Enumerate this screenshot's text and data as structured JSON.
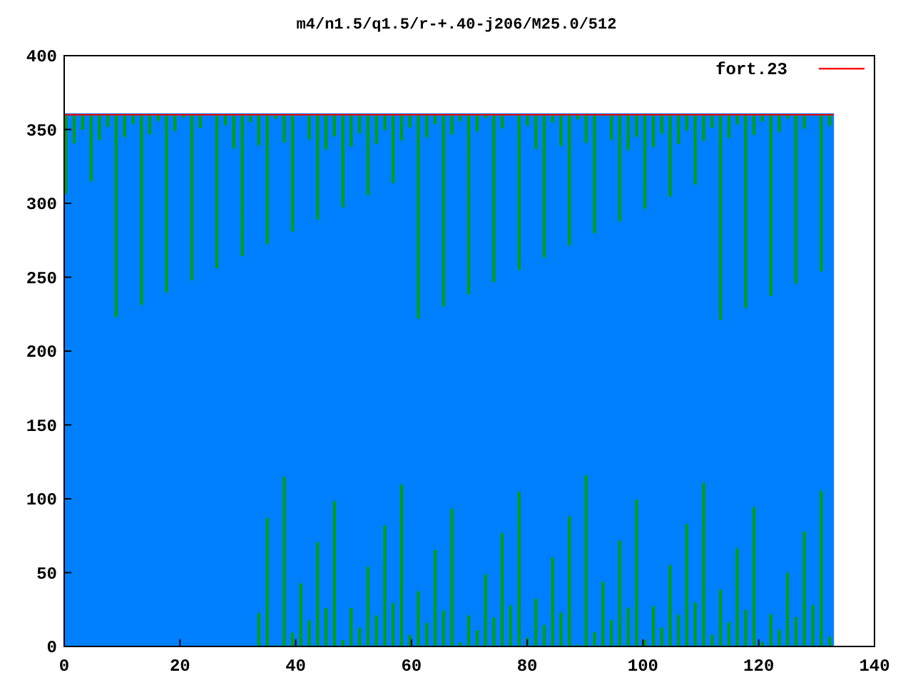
{
  "plot": {
    "title": "m4/n1.5/q1.5/r-+.40-j206/M25.0/512",
    "x_ticks": [
      "0",
      "20",
      "40",
      "60",
      "80",
      "100",
      "120",
      "140"
    ],
    "y_ticks": [
      "400",
      "350",
      "300",
      "250",
      "200",
      "150",
      "100",
      "50",
      "0"
    ],
    "legend": [
      {
        "label": "fort.23",
        "color": "#ff0000"
      }
    ]
  }
}
